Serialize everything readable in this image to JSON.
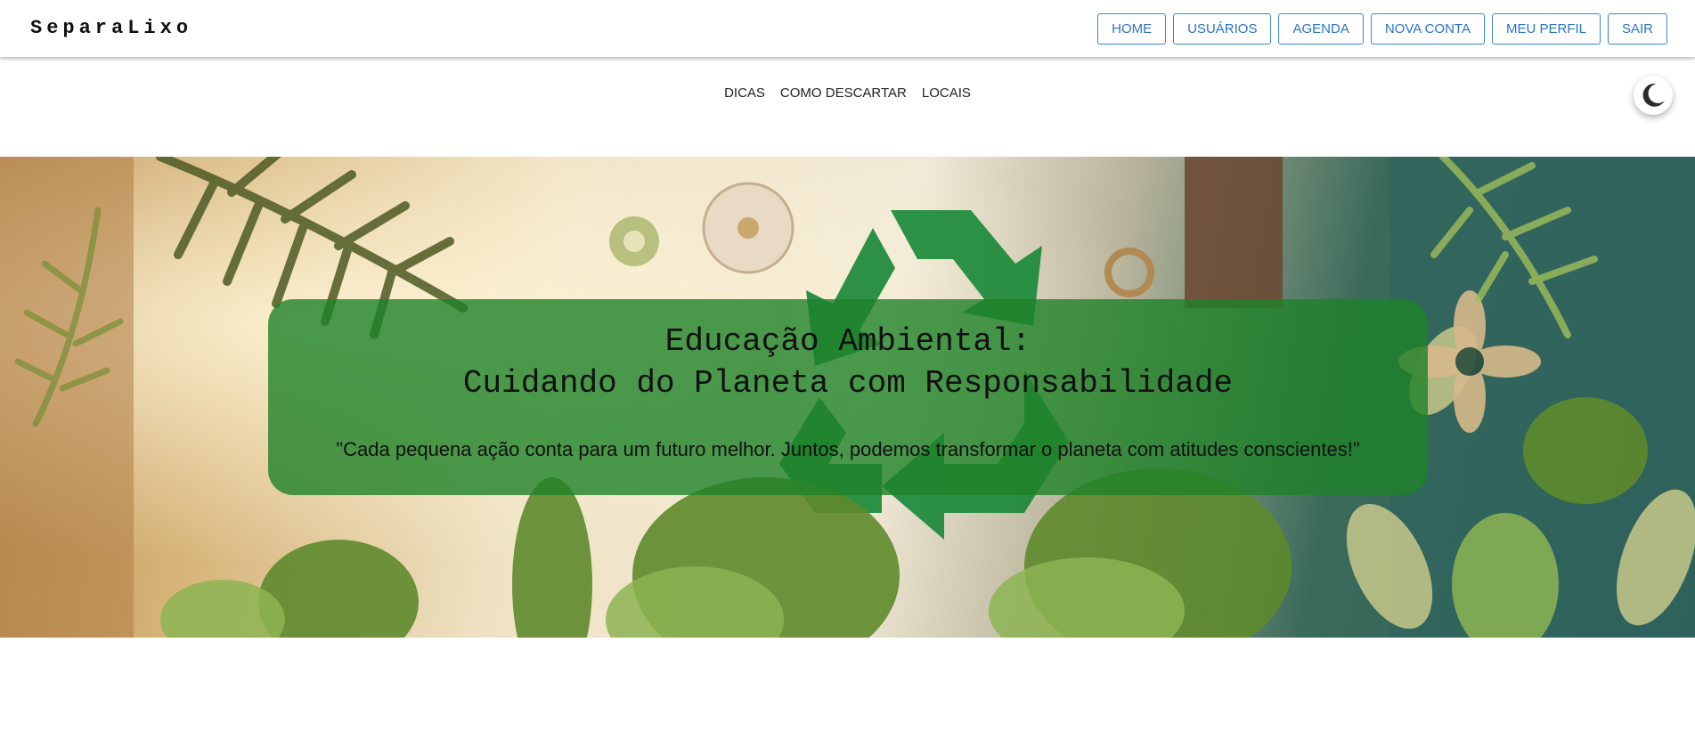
{
  "header": {
    "brand": "SeparaLixo",
    "buttons": [
      "HOME",
      "USUÁRIOS",
      "AGENDA",
      "NOVA CONTA",
      "MEU PERFIL",
      "SAIR"
    ]
  },
  "subnav": {
    "links": [
      "DICAS",
      "COMO DESCARTAR",
      "LOCAIS"
    ]
  },
  "theme_toggle": {
    "icon": "moon-icon"
  },
  "hero": {
    "background_image": "recycling-symbol-nature-collage",
    "title_line1": "Educação Ambiental:",
    "title_line2": "Cuidando do Planeta com Responsabilidade",
    "quote": "\"Cada pequena ação conta para um futuro melhor. Juntos, podemos transformar o planeta com atitudes conscientes!\""
  },
  "colors": {
    "accent": "#2a74c6",
    "card": "#1e8228",
    "recycle": "#1b8a3a"
  }
}
